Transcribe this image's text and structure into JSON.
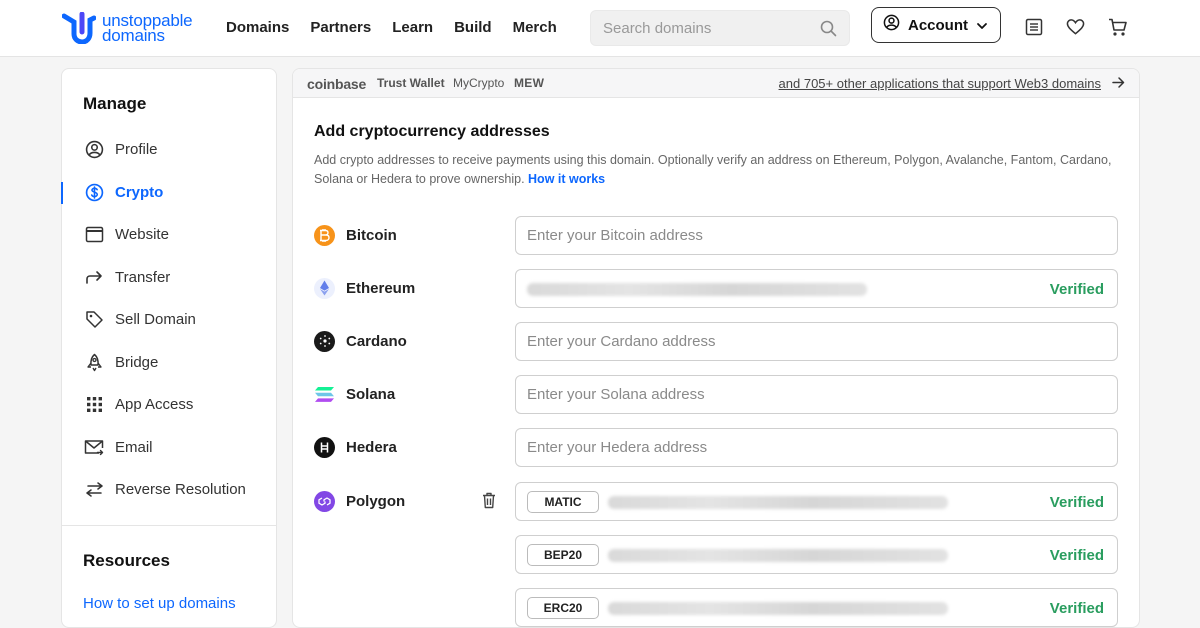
{
  "brand": {
    "line1": "unstoppable",
    "line2": "domains",
    "color": "#0d67fe"
  },
  "nav": [
    "Domains",
    "Partners",
    "Learn",
    "Build",
    "Merch"
  ],
  "search": {
    "placeholder": "Search domains"
  },
  "account": {
    "label": "Account"
  },
  "header_icons": [
    "list-icon",
    "heart-icon",
    "cart-icon"
  ],
  "sidebar": {
    "title": "Manage",
    "items": [
      {
        "label": "Profile",
        "icon": "user-circle-icon"
      },
      {
        "label": "Crypto",
        "icon": "dollar-circle-icon",
        "active": true
      },
      {
        "label": "Website",
        "icon": "browser-window-icon"
      },
      {
        "label": "Transfer",
        "icon": "arrow-forward-icon"
      },
      {
        "label": "Sell Domain",
        "icon": "tag-icon"
      },
      {
        "label": "Bridge",
        "icon": "rocket-icon"
      },
      {
        "label": "App Access",
        "icon": "grid-icon"
      },
      {
        "label": "Email",
        "icon": "mail-icon"
      },
      {
        "label": "Reverse Resolution",
        "icon": "swap-arrows-icon"
      }
    ],
    "resources_title": "Resources",
    "resources_link": "How to set up domains"
  },
  "apps_bar": {
    "apps": [
      "coinbase",
      "Trust Wallet",
      "MyCrypto",
      "MEW"
    ],
    "link": "and 705+ other applications that support Web3 domains"
  },
  "main": {
    "title": "Add cryptocurrency addresses",
    "description": "Add crypto addresses to receive payments using this domain. Optionally verify an address on Ethereum, Polygon, Avalanche, Fantom, Cardano, Solana or Hedera to prove ownership.",
    "how_link": "How it works",
    "verified_label": "Verified",
    "coins": [
      {
        "name": "Bitcoin",
        "placeholder": "Enter your Bitcoin address"
      },
      {
        "name": "Ethereum",
        "placeholder": ""
      },
      {
        "name": "Cardano",
        "placeholder": "Enter your Cardano address"
      },
      {
        "name": "Solana",
        "placeholder": "Enter your Solana address"
      },
      {
        "name": "Hedera",
        "placeholder": "Enter your Hedera address"
      },
      {
        "name": "Polygon",
        "placeholder": ""
      }
    ],
    "polygon_chips": [
      "MATIC",
      "BEP20",
      "ERC20"
    ]
  },
  "colors": {
    "bitcoin": "#f7931a",
    "ethereum": "#627eea",
    "cardano": "#1a1a1a",
    "hedera": "#111111",
    "polygon": "#8247e5",
    "verified": "#2a9d5f"
  }
}
